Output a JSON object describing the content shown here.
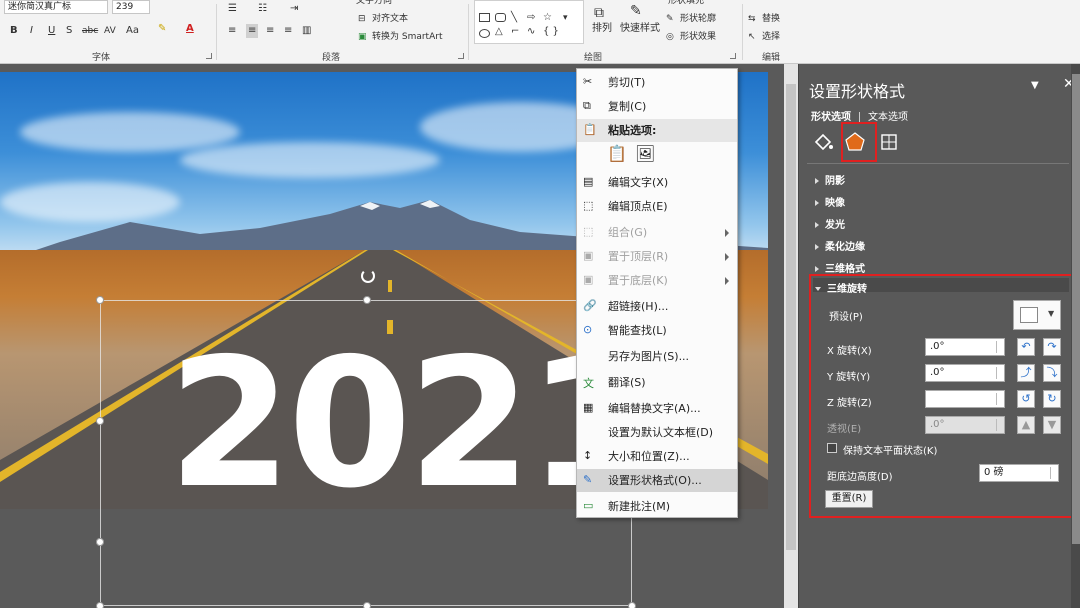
{
  "ribbon": {
    "font_name": "迷你简汉真广标",
    "font_size": "239",
    "group_font": "字体",
    "group_paragraph": "段落",
    "group_drawing": "绘图",
    "group_editing": "编辑",
    "text_dir": "文字方向",
    "align_text": "对齐文本",
    "convert_smartart": "转换为 SmartArt",
    "arrange": "排列",
    "quick_styles": "快速样式",
    "shape_fill": "形状填充",
    "shape_outline": "形状轮廓",
    "shape_effects": "形状效果",
    "replace": "替换",
    "select": "选择",
    "bold": "B",
    "italic": "I",
    "underline": "U",
    "shadow": "S",
    "strike": "abc",
    "spacing": "AV",
    "case": "Aa"
  },
  "slide": {
    "year_text": "2021"
  },
  "context_menu": {
    "items": [
      {
        "label": "剪切(T)",
        "icon": "scissors-icon",
        "enabled": true
      },
      {
        "label": "复制(C)",
        "icon": "copy-icon",
        "enabled": true
      },
      {
        "label": "粘贴选项:",
        "icon": "paste-icon",
        "enabled": true,
        "section": true
      },
      {
        "label": "编辑文字(X)",
        "icon": "edit-text-icon",
        "enabled": true
      },
      {
        "label": "编辑顶点(E)",
        "icon": "edit-points-icon",
        "enabled": true
      },
      {
        "label": "组合(G)",
        "icon": "group-icon",
        "enabled": false,
        "submenu": true
      },
      {
        "label": "置于顶层(R)",
        "icon": "bring-front-icon",
        "enabled": false,
        "submenu": true
      },
      {
        "label": "置于底层(K)",
        "icon": "send-back-icon",
        "enabled": false,
        "submenu": true
      },
      {
        "label": "超链接(H)...",
        "icon": "hyperlink-icon",
        "enabled": true
      },
      {
        "label": "智能查找(L)",
        "icon": "smart-lookup-icon",
        "enabled": true
      },
      {
        "label": "另存为图片(S)...",
        "icon": "",
        "enabled": true
      },
      {
        "label": "翻译(S)",
        "icon": "translate-icon",
        "enabled": true
      },
      {
        "label": "编辑替换文字(A)...",
        "icon": "alt-text-icon",
        "enabled": true
      },
      {
        "label": "设置为默认文本框(D)",
        "icon": "",
        "enabled": true
      },
      {
        "label": "大小和位置(Z)...",
        "icon": "size-position-icon",
        "enabled": true
      },
      {
        "label": "设置形状格式(O)...",
        "icon": "format-shape-icon",
        "enabled": true,
        "highlighted": true
      },
      {
        "label": "新建批注(M)",
        "icon": "comment-icon",
        "enabled": true
      }
    ]
  },
  "pane": {
    "title": "设置形状格式",
    "tab_shape": "形状选项",
    "tab_text": "文本选项",
    "sections": [
      "阴影",
      "映像",
      "发光",
      "柔化边缘",
      "三维格式"
    ],
    "rotation_section": "三维旋转",
    "preset_label": "预设(P)",
    "x_label": "X 旋转(X)",
    "x_value": ".0°",
    "y_label": "Y 旋转(Y)",
    "y_value": ".0°",
    "z_label": "Z 旋转(Z)",
    "z_value": "",
    "perspective_label": "透视(E)",
    "perspective_value": ".0°",
    "keep_flat_label": "保持文本平面状态(K)",
    "distance_label": "距底边高度(D)",
    "distance_value": "0 磅",
    "reset_label": "重置(R)"
  },
  "colors": {
    "accent_red": "#e02020",
    "pane_bg": "#595959",
    "highlight": "#d5d5d5"
  }
}
